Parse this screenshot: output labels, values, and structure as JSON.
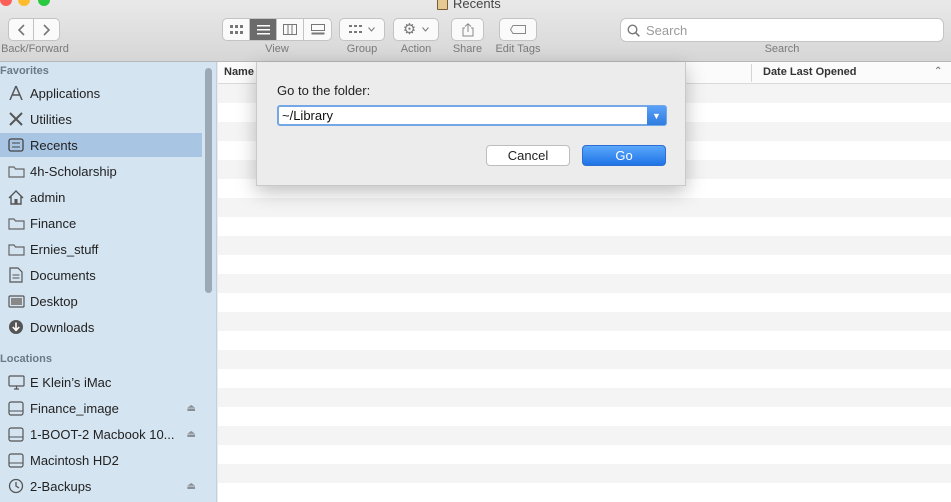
{
  "window": {
    "title": "Recents"
  },
  "toolbar": {
    "back_forward_label": "Back/Forward",
    "view_label": "View",
    "group_label": "Group",
    "action_label": "Action",
    "share_label": "Share",
    "edit_tags_label": "Edit Tags",
    "search_placeholder": "Search",
    "search_label": "Search"
  },
  "sidebar": {
    "favorites_header": "Favorites",
    "favorites": [
      {
        "label": "Applications",
        "icon": "applications-icon"
      },
      {
        "label": "Utilities",
        "icon": "utilities-icon"
      },
      {
        "label": "Recents",
        "icon": "recents-icon",
        "selected": true
      },
      {
        "label": "4h-Scholarship",
        "icon": "folder-icon"
      },
      {
        "label": "admin",
        "icon": "home-icon"
      },
      {
        "label": "Finance",
        "icon": "folder-icon"
      },
      {
        "label": "Ernies_stuff",
        "icon": "folder-icon"
      },
      {
        "label": "Documents",
        "icon": "documents-icon"
      },
      {
        "label": "Desktop",
        "icon": "desktop-icon"
      },
      {
        "label": "Downloads",
        "icon": "downloads-icon"
      }
    ],
    "locations_header": "Locations",
    "locations": [
      {
        "label": "E Klein’s iMac",
        "icon": "imac-icon",
        "eject": false
      },
      {
        "label": "Finance_image",
        "icon": "disk-icon",
        "eject": true
      },
      {
        "label": "1-BOOT-2 Macbook 10...",
        "icon": "disk-icon",
        "eject": true
      },
      {
        "label": "Macintosh HD2",
        "icon": "disk-icon",
        "eject": false
      },
      {
        "label": "2-Backups",
        "icon": "time-machine-icon",
        "eject": true
      }
    ]
  },
  "list": {
    "columns": {
      "name": "Name",
      "date": "Date Last Opened"
    }
  },
  "dialog": {
    "label": "Go to the folder:",
    "path_value": "~/Library",
    "cancel_label": "Cancel",
    "go_label": "Go"
  },
  "colors": {
    "accent": "#2f7de0",
    "sidebar_bg": "#d4e4f1",
    "sidebar_selected": "#a8c6e4"
  }
}
